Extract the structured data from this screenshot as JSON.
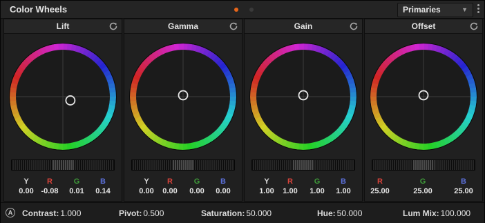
{
  "window": {
    "title": "Color Wheels",
    "mode": "Primaries",
    "page_dots": 2,
    "active_page": 1
  },
  "colors": {
    "Y": "#d8d8d8",
    "R": "#d8433b",
    "G": "#3f9a3a",
    "B": "#5b6fd8",
    "accent": "#e8661a"
  },
  "wheels": [
    {
      "name": "Lift",
      "puck": {
        "dx": 0.16,
        "dy": 0.08
      },
      "values": [
        {
          "ch": "Y",
          "val": "0.00"
        },
        {
          "ch": "R",
          "val": "-0.08"
        },
        {
          "ch": "G",
          "val": "0.01"
        },
        {
          "ch": "B",
          "val": "0.14"
        }
      ]
    },
    {
      "name": "Gamma",
      "puck": {
        "dx": 0.0,
        "dy": -0.03
      },
      "values": [
        {
          "ch": "Y",
          "val": "0.00"
        },
        {
          "ch": "R",
          "val": "0.00"
        },
        {
          "ch": "G",
          "val": "0.00"
        },
        {
          "ch": "B",
          "val": "0.00"
        }
      ]
    },
    {
      "name": "Gain",
      "puck": {
        "dx": 0.0,
        "dy": -0.03
      },
      "values": [
        {
          "ch": "Y",
          "val": "1.00"
        },
        {
          "ch": "R",
          "val": "1.00"
        },
        {
          "ch": "G",
          "val": "1.00"
        },
        {
          "ch": "B",
          "val": "1.00"
        }
      ]
    },
    {
      "name": "Offset",
      "puck": {
        "dx": 0.0,
        "dy": -0.03
      },
      "values": [
        {
          "ch": "R",
          "val": "25.00"
        },
        {
          "ch": "G",
          "val": "25.00"
        },
        {
          "ch": "B",
          "val": "25.00"
        }
      ]
    }
  ],
  "footer": {
    "auto_label": "A",
    "contrast": {
      "label": "Contrast:",
      "value": "1.000"
    },
    "pivot": {
      "label": "Pivot:",
      "value": "0.500"
    },
    "saturation": {
      "label": "Saturation:",
      "value": "50.000"
    },
    "hue": {
      "label": "Hue:",
      "value": "50.000"
    },
    "lum_mix": {
      "label": "Lum Mix:",
      "value": "100.000"
    }
  }
}
